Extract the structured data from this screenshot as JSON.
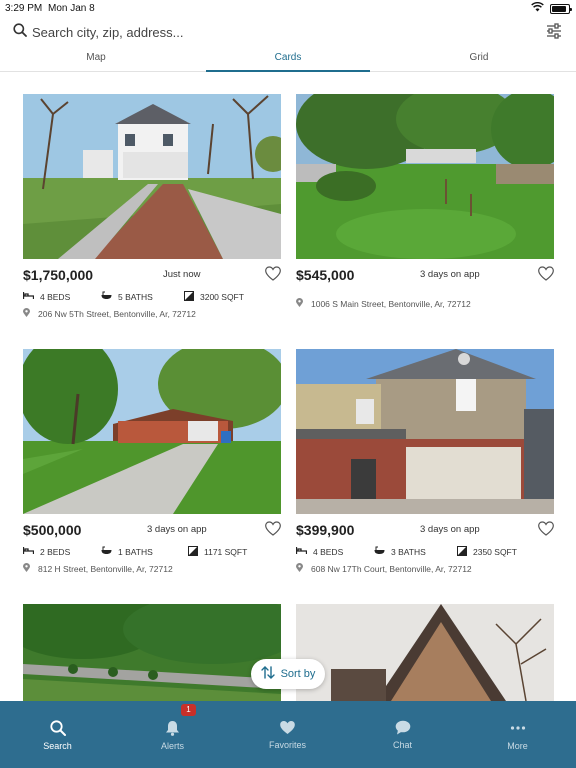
{
  "status_bar": {
    "time": "3:29 PM",
    "date": "Mon Jan 8",
    "battery_level": 0.85
  },
  "search": {
    "placeholder": "Search city, zip, address..."
  },
  "tabs": [
    {
      "label": "Map"
    },
    {
      "label": "Cards",
      "active": true
    },
    {
      "label": "Grid"
    }
  ],
  "listings": [
    {
      "price": "$1,750,000",
      "posted": "Just now",
      "beds": "4 BEDS",
      "baths": "5 BATHS",
      "sqft": "3200 SQFT",
      "address": "206 Nw 5Th Street, Bentonville, Ar, 72712"
    },
    {
      "price": "$545,000",
      "posted": "3 days on app",
      "beds": "",
      "baths": "",
      "sqft": "",
      "address": "1006 S Main Street, Bentonville, Ar, 72712"
    },
    {
      "price": "$500,000",
      "posted": "3 days on app",
      "beds": "2 BEDS",
      "baths": "1 BATHS",
      "sqft": "1171 SQFT",
      "address": "812 H Street, Bentonville, Ar, 72712"
    },
    {
      "price": "$399,900",
      "posted": "3 days on app",
      "beds": "4 BEDS",
      "baths": "3 BATHS",
      "sqft": "2350 SQFT",
      "address": "608 Nw 17Th Court, Bentonville, Ar, 72712"
    }
  ],
  "sort_button": {
    "label": "Sort by"
  },
  "bottom_nav": {
    "items": [
      {
        "label": "Search",
        "icon": "search-icon",
        "active": true
      },
      {
        "label": "Alerts",
        "icon": "bell-icon",
        "badge": "1"
      },
      {
        "label": "Favorites",
        "icon": "heart-icon"
      },
      {
        "label": "Chat",
        "icon": "chat-bubble-icon"
      },
      {
        "label": "More",
        "icon": "more-dots-icon"
      }
    ]
  },
  "colors": {
    "accent": "#1f6d8e",
    "nav_bg": "#2e6d8f",
    "badge": "#c8302a"
  }
}
